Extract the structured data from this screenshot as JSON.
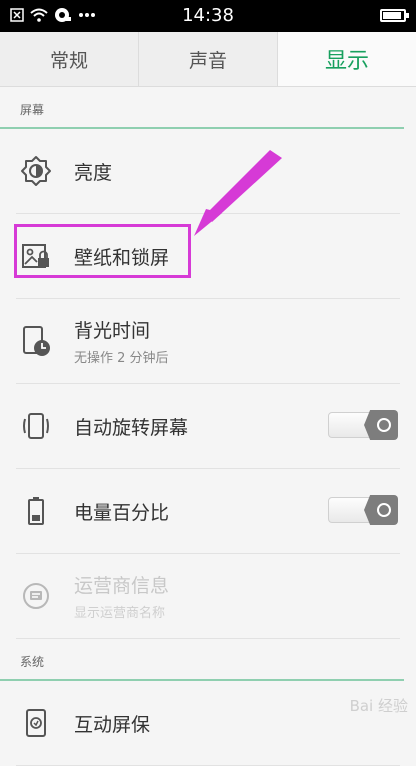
{
  "status_bar": {
    "time": "14:38"
  },
  "tabs": [
    {
      "label": "常规",
      "active": false
    },
    {
      "label": "声音",
      "active": false
    },
    {
      "label": "显示",
      "active": true
    }
  ],
  "sections": {
    "screen": {
      "header": "屏幕"
    },
    "system": {
      "header": "系统"
    }
  },
  "rows": {
    "brightness": {
      "title": "亮度"
    },
    "wallpaper": {
      "title": "壁纸和锁屏"
    },
    "backlight": {
      "title": "背光时间",
      "subtitle": "无操作 2 分钟后"
    },
    "autorotate": {
      "title": "自动旋转屏幕",
      "toggle": "off"
    },
    "battery_percent": {
      "title": "电量百分比",
      "toggle": "off"
    },
    "carrier": {
      "title": "运营商信息",
      "subtitle": "显示运营商名称",
      "disabled": true
    },
    "interactive_screensaver": {
      "title": "互动屏保"
    }
  },
  "colors": {
    "accent": "#17a05e",
    "highlight": "#d63ad6",
    "toggle_knob": "#7d7d7d"
  },
  "watermark": {
    "text": "Bai 经验"
  }
}
